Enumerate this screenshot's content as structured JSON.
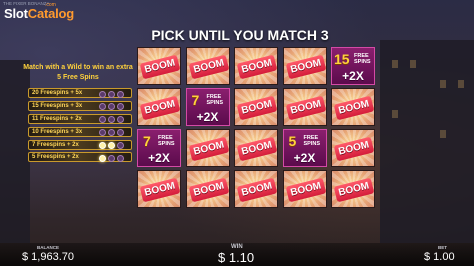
{
  "header": {
    "game_name": "THE FIXER BONANZA",
    "watermark_main": "Slot",
    "watermark_accent": "Catalog",
    "watermark_tld": ".com"
  },
  "title": "PICK UNTIL YOU MATCH 3",
  "promo_text": "Match with a Wild to win an extra 5 Free Spins",
  "ladder": [
    {
      "label": "20 Freespins + 5x",
      "lit": 0
    },
    {
      "label": "15 Freespins + 3x",
      "lit": 0
    },
    {
      "label": "11 Freespins + 2x",
      "lit": 0
    },
    {
      "label": "10 Freespins + 3x",
      "lit": 0
    },
    {
      "label": "7 Freespins + 2x",
      "lit": 2
    },
    {
      "label": "5 Freespins + 2x",
      "lit": 1
    }
  ],
  "grid": {
    "boom_text": "BOOM",
    "free_label": "FREE SPINS",
    "rows": [
      [
        {
          "type": "boom"
        },
        {
          "type": "boom"
        },
        {
          "type": "boom"
        },
        {
          "type": "boom"
        },
        {
          "type": "prize",
          "number": "15",
          "mult": "+2X"
        }
      ],
      [
        {
          "type": "boom"
        },
        {
          "type": "prize",
          "number": "7",
          "mult": "+2X"
        },
        {
          "type": "boom"
        },
        {
          "type": "boom"
        },
        {
          "type": "boom"
        }
      ],
      [
        {
          "type": "prize",
          "number": "7",
          "mult": "+2X"
        },
        {
          "type": "boom"
        },
        {
          "type": "boom"
        },
        {
          "type": "prize",
          "number": "5",
          "mult": "+2X"
        },
        {
          "type": "boom"
        }
      ],
      [
        {
          "type": "boom"
        },
        {
          "type": "boom"
        },
        {
          "type": "boom"
        },
        {
          "type": "boom"
        },
        {
          "type": "boom"
        }
      ]
    ]
  },
  "footer": {
    "balance_label": "BALANCE",
    "balance_value": "$ 1,963.70",
    "win_label": "WIN",
    "win_value": "$ 1.10",
    "bet_label": "BET",
    "bet_value": "$ 1.00"
  },
  "colors": {
    "title": "#ffffff",
    "promo": "#ffd23c",
    "boom_badge": "#e02443",
    "prize_tile": "#6f1660",
    "ladder_border": "#c99a2c"
  }
}
